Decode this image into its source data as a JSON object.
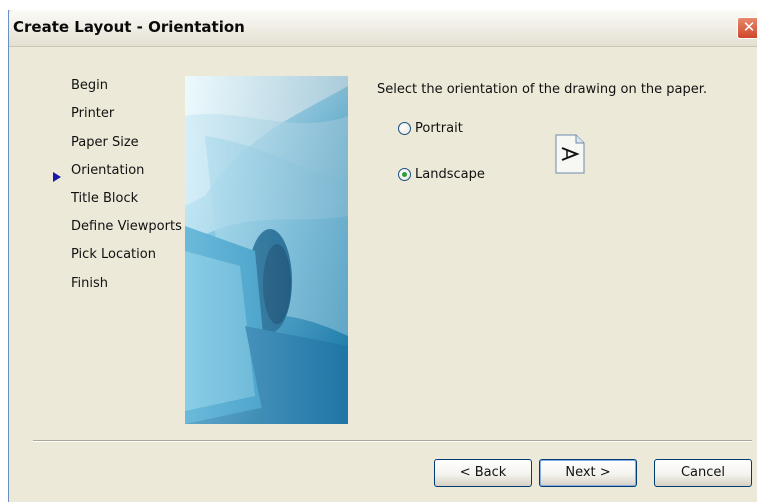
{
  "window": {
    "title": "Create Layout - Orientation",
    "close_glyph": "✕"
  },
  "steps": {
    "items": [
      {
        "label": "Begin"
      },
      {
        "label": "Printer"
      },
      {
        "label": "Paper Size"
      },
      {
        "label": "Orientation",
        "current": true
      },
      {
        "label": "Title Block"
      },
      {
        "label": "Define Viewports"
      },
      {
        "label": "Pick Location"
      },
      {
        "label": "Finish"
      }
    ]
  },
  "main": {
    "prompt": "Select the orientation of the drawing on the paper.",
    "options": [
      {
        "label": "Portrait",
        "selected": false
      },
      {
        "label": "Landscape",
        "selected": true
      }
    ],
    "preview_icon": "landscape-page-icon",
    "preview_letter": "A"
  },
  "buttons": {
    "back_label": "< Back",
    "next_label": "Next >",
    "cancel_label": "Cancel"
  },
  "colors": {
    "dialog_bg": "#ece9d8",
    "arrow": "#1a1aa8",
    "radio_dot": "#2f9c3a",
    "close_btn": "#d0472a"
  }
}
